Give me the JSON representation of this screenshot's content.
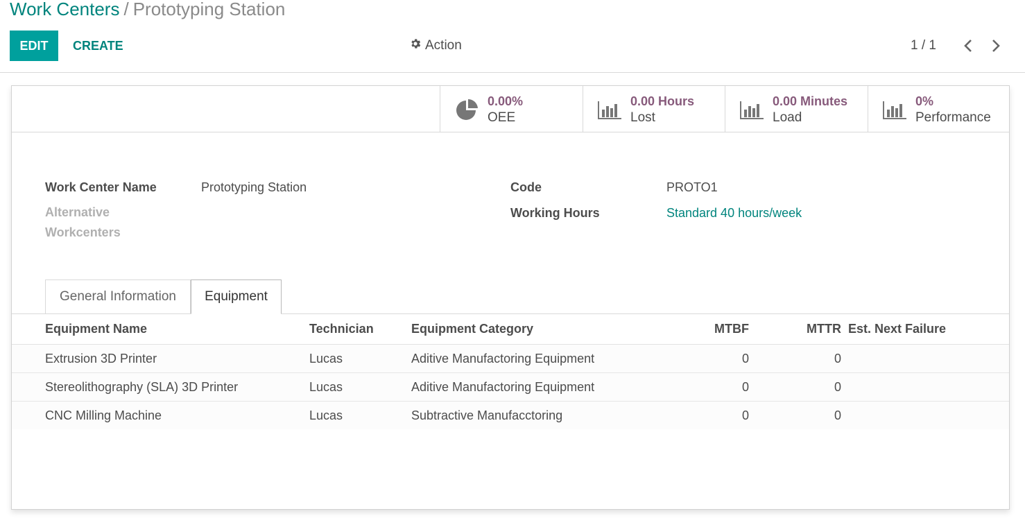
{
  "breadcrumb": {
    "parent": "Work Centers",
    "separator": "/",
    "current": "Prototyping Station"
  },
  "toolbar": {
    "edit_label": "EDIT",
    "create_label": "CREATE",
    "action_label": "Action",
    "action_icon": "gear-icon"
  },
  "pager": {
    "value": "1 / 1"
  },
  "stat_buttons": [
    {
      "value": "0.00%",
      "label": "OEE",
      "icon": "pie-chart-icon"
    },
    {
      "value": "0.00 Hours",
      "label": "Lost",
      "icon": "bar-chart-icon"
    },
    {
      "value": "0.00 Minutes",
      "label": "Load",
      "icon": "bar-chart-icon"
    },
    {
      "value": "0%",
      "label": "Performance",
      "icon": "bar-chart-icon"
    }
  ],
  "form": {
    "work_center_name_label": "Work Center Name",
    "work_center_name": "Prototyping Station",
    "alternative_label_line1": "Alternative",
    "alternative_label_line2": "Workcenters",
    "code_label": "Code",
    "code": "PROTO1",
    "working_hours_label": "Working Hours",
    "working_hours": "Standard 40 hours/week"
  },
  "tabs": [
    {
      "label": "General Information",
      "active": false
    },
    {
      "label": "Equipment",
      "active": true
    }
  ],
  "table": {
    "headers": [
      "Equipment Name",
      "Technician",
      "Equipment Category",
      "MTBF",
      "MTTR",
      "Est. Next Failure"
    ],
    "rows": [
      {
        "name": "Extrusion 3D Printer",
        "technician": "Lucas",
        "category": "Aditive Manufactoring Equipment",
        "mtbf": "0",
        "mttr": "0",
        "next_failure": ""
      },
      {
        "name": "Stereolithography (SLA) 3D Printer",
        "technician": "Lucas",
        "category": "Aditive Manufactoring Equipment",
        "mtbf": "0",
        "mttr": "0",
        "next_failure": ""
      },
      {
        "name": "CNC Milling Machine",
        "technician": "Lucas",
        "category": "Subtractive Manufacctoring",
        "mtbf": "0",
        "mttr": "0",
        "next_failure": ""
      }
    ]
  },
  "colors": {
    "primary": "#00a09d",
    "link": "#00847d",
    "stat_value": "#875a7b",
    "text": "#4c4c4c",
    "muted": "#b0b0b0"
  }
}
